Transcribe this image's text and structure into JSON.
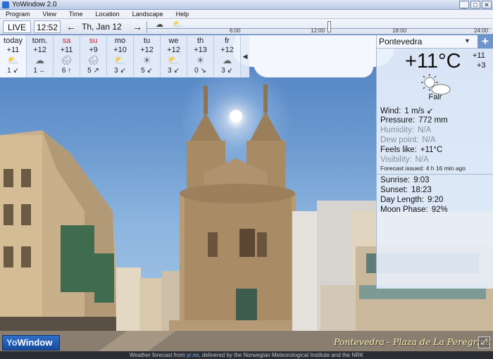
{
  "window": {
    "title": "YoWindow 2.0",
    "controls": [
      "_",
      "□",
      "✕"
    ]
  },
  "menu": [
    "Program",
    "View",
    "Time",
    "Location",
    "Landscape",
    "Help"
  ],
  "toolbar": {
    "live": "LIVE",
    "time": "12:52",
    "prev": "←",
    "date": "Th, Jan 12",
    "next": "→",
    "timeline_labels": [
      "6:00",
      "12:00",
      "18:00",
      "24:00"
    ]
  },
  "forecast": [
    {
      "day": "today",
      "temp": "+11",
      "icon": "sun-cloud-icon",
      "glyph": "⛅",
      "wind": "1 ↙",
      "weekend": false
    },
    {
      "day": "tom.",
      "temp": "+12",
      "icon": "cloud-icon",
      "glyph": "☁",
      "wind": "1 ←",
      "weekend": false
    },
    {
      "day": "sa",
      "temp": "+11",
      "icon": "rain-cloud-icon",
      "glyph": "🌧",
      "wind": "6 ↑",
      "weekend": true
    },
    {
      "day": "su",
      "temp": "+9",
      "icon": "rain-cloud-icon",
      "glyph": "🌧",
      "wind": "5 ↗",
      "weekend": true
    },
    {
      "day": "mo",
      "temp": "+10",
      "icon": "sun-cloud-icon",
      "glyph": "⛅",
      "wind": "3 ↙",
      "weekend": false
    },
    {
      "day": "tu",
      "temp": "+12",
      "icon": "sun-icon",
      "glyph": "☀",
      "wind": "5 ↙",
      "weekend": false
    },
    {
      "day": "we",
      "temp": "+12",
      "icon": "sun-cloud-icon",
      "glyph": "⛅",
      "wind": "3 ↙",
      "weekend": false
    },
    {
      "day": "th",
      "temp": "+13",
      "icon": "sun-icon",
      "glyph": "☀",
      "wind": "0 ↘",
      "weekend": false
    },
    {
      "day": "fr",
      "temp": "+12",
      "icon": "cloud-icon",
      "glyph": "☁",
      "wind": "3 ↙",
      "weekend": false
    }
  ],
  "panel": {
    "city": "Pontevedra",
    "dropdown": "▼",
    "add": "+",
    "temp": "+11°C",
    "high": "+11",
    "low": "+3",
    "condition": "Fair",
    "wind_label": "Wind:",
    "wind": "1 m/s ↙",
    "pressure_label": "Pressure:",
    "pressure": "772 mm",
    "humidity_label": "Humidity:",
    "humidity": "N/A",
    "dew_label": "Dew point:",
    "dew": "N/A",
    "feels_label": "Feels like:",
    "feels": "+11°C",
    "visibility_label": "Visibility:",
    "visibility": "N/A",
    "issued": "Forecast issued:  4 h 16 min ago",
    "sunrise_label": "Sunrise:",
    "sunrise": "9:03",
    "sunset_label": "Sunset:",
    "sunset": "18:23",
    "daylength_label": "Day Length:",
    "daylength": "9:20",
    "moon_label": "Moon Phase:",
    "moon": "92%"
  },
  "footer": {
    "logo_a": "Yo",
    "logo_b": "Window",
    "location": "Pontevedra - Plaza de La Peregrina",
    "expand": "⤢",
    "status_a": "Weather forecast from ",
    "status_link": "yr.no",
    "status_b": ", delivered by the Norwegian Meteorological Institute and the NRK"
  },
  "colors": {
    "sky_top": "#4d7fc0",
    "panel": "#e8effb",
    "weekend": "#c8252b",
    "logo": "#2e6fc9",
    "place_text": "#fff4b0"
  }
}
